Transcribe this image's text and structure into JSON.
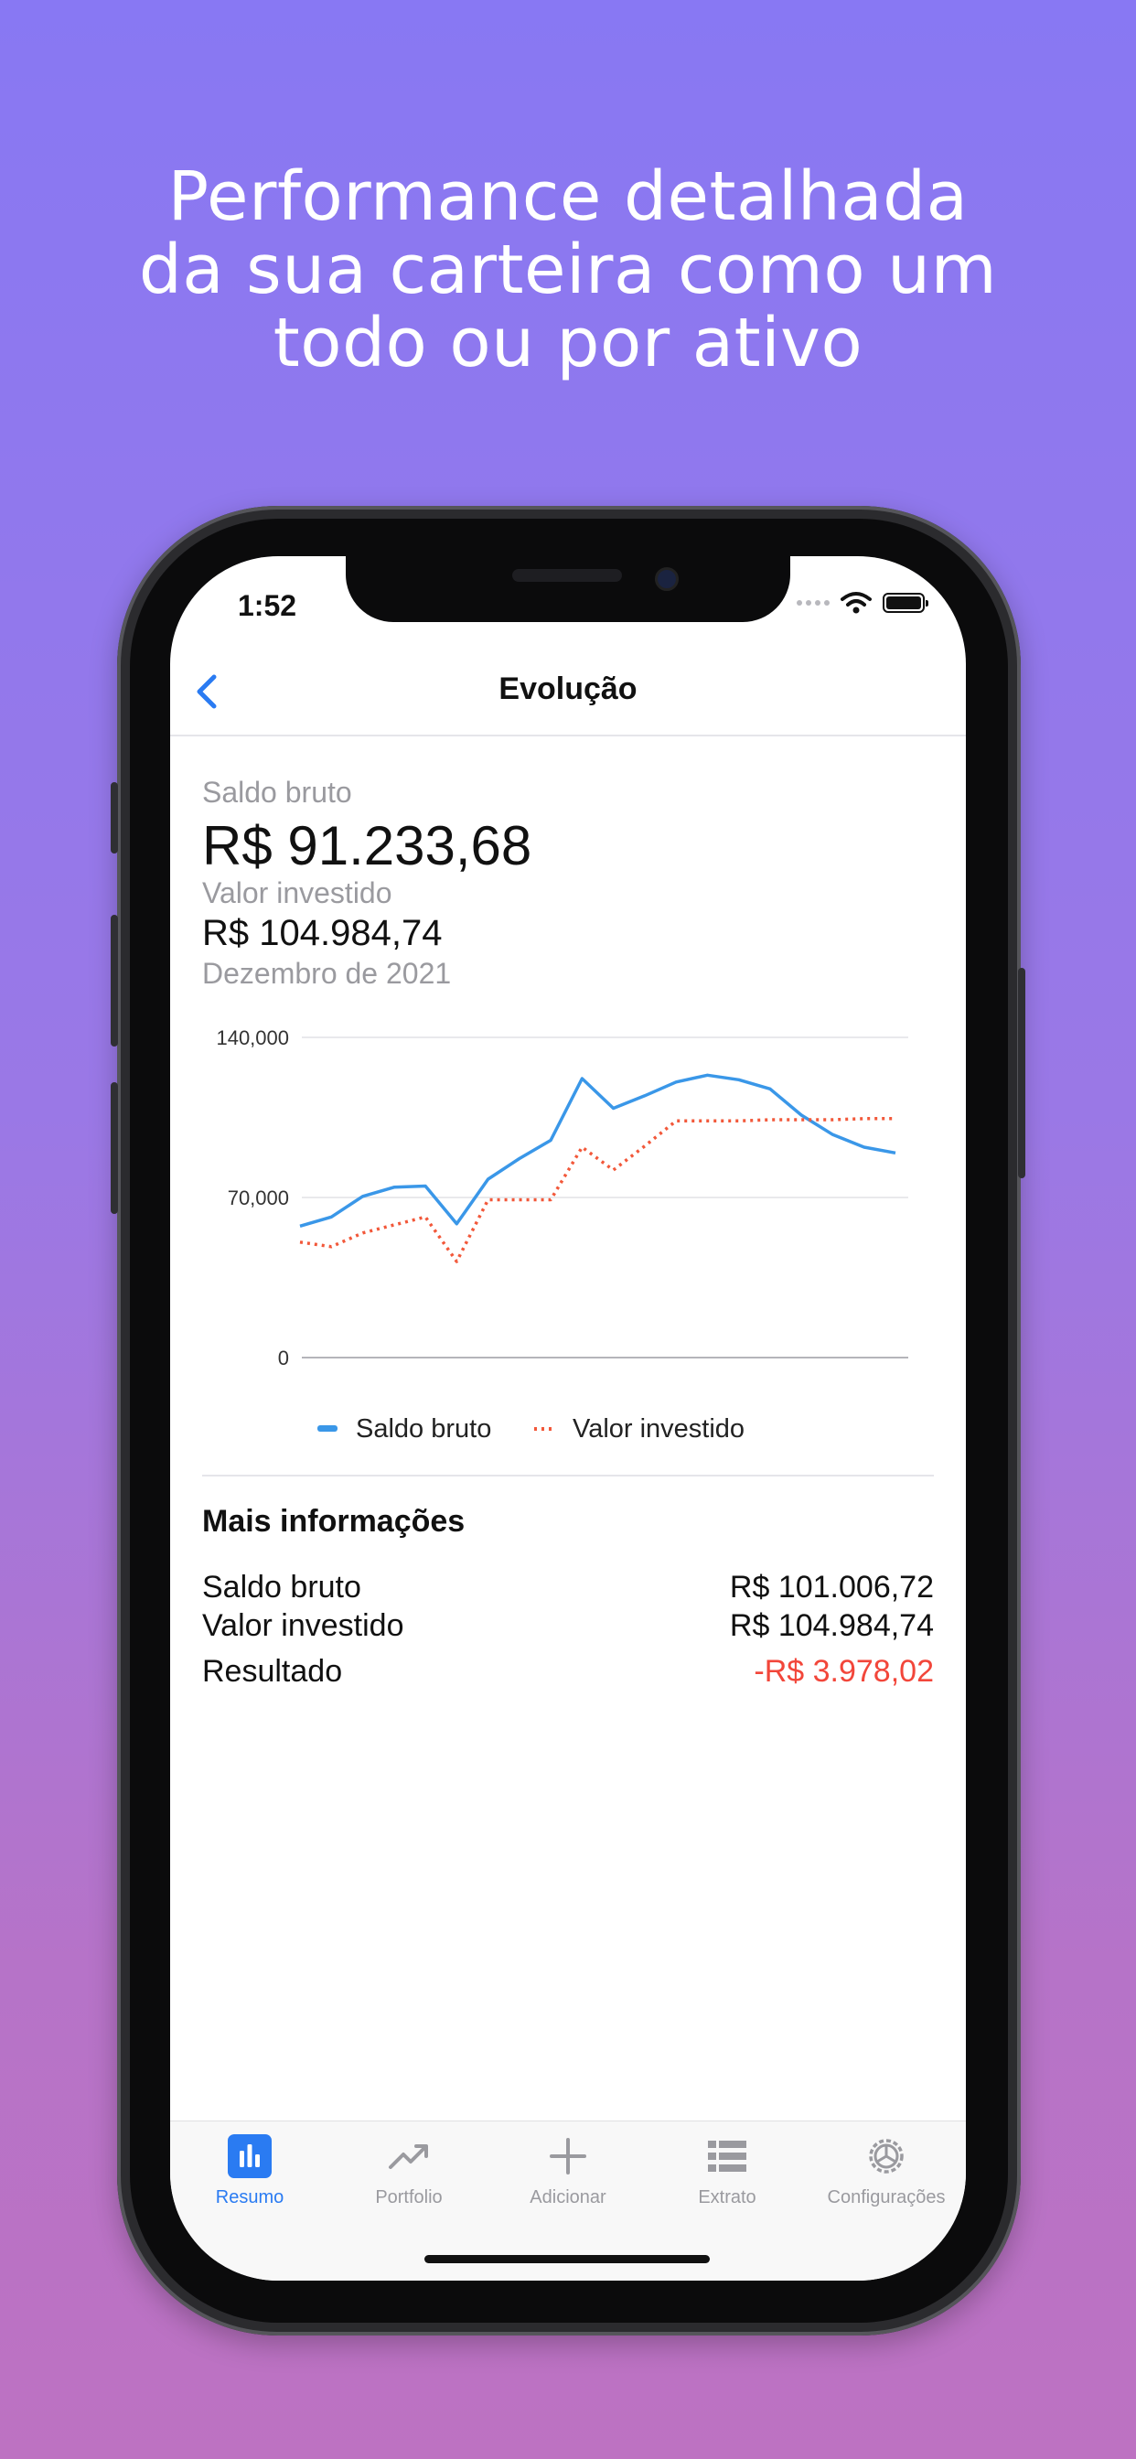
{
  "promo": {
    "headline_lines": [
      "Performance detalhada",
      "da sua carteira como um",
      "todo ou por ativo"
    ]
  },
  "status_bar": {
    "time": "1:52"
  },
  "nav": {
    "title": "Evolução"
  },
  "summary": {
    "saldo_label": "Saldo bruto",
    "saldo_value": "R$ 91.233,68",
    "investido_label": "Valor investido",
    "investido_value": "R$ 104.984,74",
    "period": "Dezembro de 2021"
  },
  "chart_data": {
    "type": "line",
    "y_ticks": [
      "140,000",
      "70,000",
      "0"
    ],
    "ylim": [
      0,
      140000
    ],
    "grid": true,
    "legend": "bottom",
    "series": [
      {
        "name": "Saldo bruto",
        "color": "#3a97e8",
        "style": "solid",
        "values": [
          57500,
          61500,
          70500,
          74500,
          75000,
          58500,
          78000,
          87000,
          95000,
          122000,
          109000,
          114500,
          120500,
          123500,
          121500,
          117500,
          106000,
          97500,
          92000,
          89500
        ]
      },
      {
        "name": "Valor investido",
        "color": "#f2583a",
        "style": "dotted",
        "values": [
          50500,
          48500,
          54500,
          58000,
          61500,
          42000,
          69000,
          69000,
          69000,
          92000,
          82000,
          92500,
          103500,
          103500,
          103500,
          104000,
          104000,
          104000,
          104500,
          104500
        ]
      }
    ]
  },
  "more_info": {
    "title": "Mais informações",
    "rows": [
      {
        "label": "Saldo bruto",
        "value": "R$ 101.006,72"
      },
      {
        "label": "Valor investido",
        "value": "R$ 104.984,74"
      },
      {
        "label": "Resultado",
        "value": "-R$ 3.978,02"
      }
    ]
  },
  "colors": {
    "accent": "#2a7bf2",
    "negative": "#f2463a"
  },
  "tabbar": {
    "tabs": [
      {
        "label": "Resumo",
        "icon": "bar-chart-icon",
        "active": true
      },
      {
        "label": "Portfolio",
        "icon": "trend-up-icon",
        "active": false
      },
      {
        "label": "Adicionar",
        "icon": "plus-icon",
        "active": false
      },
      {
        "label": "Extrato",
        "icon": "list-icon",
        "active": false
      },
      {
        "label": "Configurações",
        "icon": "gear-icon",
        "active": false
      }
    ]
  }
}
